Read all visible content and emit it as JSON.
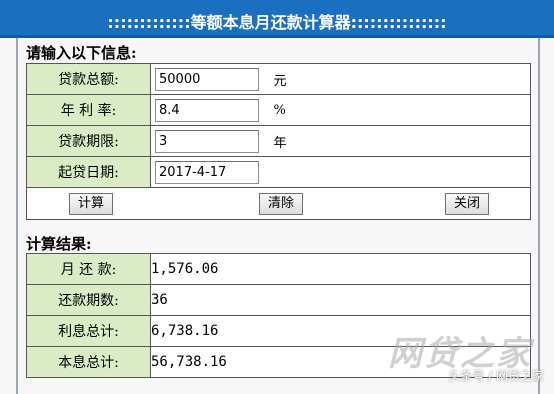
{
  "title": ":::::::::::::等额本息月还款计算器:::::::::::::::",
  "input_section": {
    "heading": "请输入以下信息:",
    "rows": [
      {
        "label": "贷款总额:",
        "value": "50000",
        "unit": "元"
      },
      {
        "label": "年 利 率:",
        "value": "8.4",
        "unit": "%"
      },
      {
        "label": "贷款期限:",
        "value": "3",
        "unit": "年"
      },
      {
        "label": "起贷日期:",
        "value": "2017-4-17",
        "unit": ""
      }
    ],
    "buttons": {
      "calculate": "计算",
      "clear": "清除",
      "close": "关闭"
    }
  },
  "result_section": {
    "heading": "计算结果:",
    "rows": [
      {
        "label": "月 还 款:",
        "value": "1,576.06"
      },
      {
        "label": "还款期数:",
        "value": "36"
      },
      {
        "label": "利息总计:",
        "value": "6,738.16"
      },
      {
        "label": "本息总计:",
        "value": "56,738.16"
      }
    ]
  },
  "watermark": {
    "logo": "网贷之家",
    "caption": "头条号 / 网贷之家"
  },
  "colors": {
    "title_bar": "#1a6fc1",
    "label_bg": "#d9ecc6"
  }
}
